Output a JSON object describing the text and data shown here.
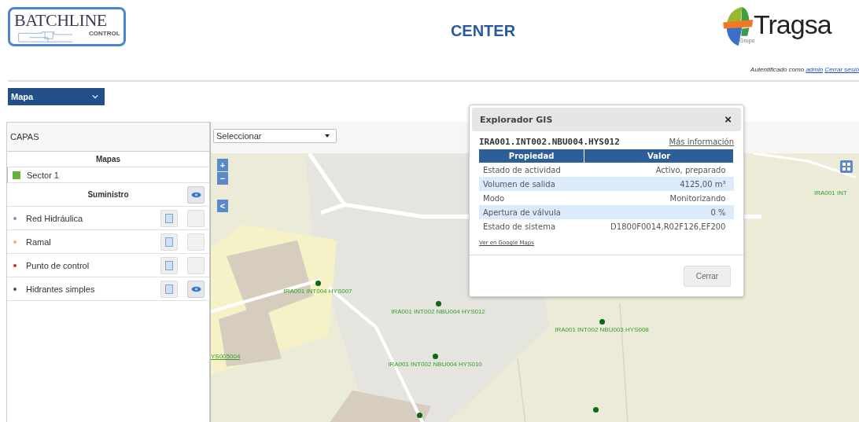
{
  "header": {
    "logo_text": "BATCHLINE",
    "logo_subtext": "CONTROL",
    "title": "CENTER",
    "brand_text": "Tragsa",
    "brand_subtext": "Grupo",
    "auth_label": "Autentificado como",
    "auth_user": "admin",
    "logout": "Cerrar sesió"
  },
  "view_select": {
    "value": "Mapa"
  },
  "layers_panel": {
    "title": "CAPAS",
    "rows": [
      {
        "kind": "section",
        "label": "Mapas"
      },
      {
        "kind": "map",
        "label": "Sector 1"
      },
      {
        "kind": "group",
        "label": "Suministro",
        "visible": true
      },
      {
        "kind": "layer",
        "label": "Red Hidráulica",
        "color": "#8a8ad0",
        "visible": false
      },
      {
        "kind": "layer",
        "label": "Ramal",
        "color": "#e8b070",
        "visible": false
      },
      {
        "kind": "layer",
        "label": "Punto de control",
        "color": "#e02020",
        "visible": false
      },
      {
        "kind": "layer",
        "label": "Hidrantes simples",
        "color": "#207020",
        "visible": true
      }
    ]
  },
  "map": {
    "select": {
      "value": "Seleccionar"
    },
    "zoom_in": "+",
    "zoom_out": "−",
    "collapse": "<",
    "markers": [
      {
        "kind": "labeled",
        "label": "IRA001 INT004 HYS007"
      },
      {
        "kind": "labeled",
        "label": "IRA001 INT002 NBU004 HYS012"
      },
      {
        "kind": "labeled",
        "label": "IRA001 INT002 NBU004 HYS010"
      },
      {
        "kind": "labeled",
        "label": "IRA001 INT002 NBU003 HYS008"
      },
      {
        "kind": "dot"
      },
      {
        "kind": "dot"
      },
      {
        "kind": "text",
        "label": "IRA001 INT"
      },
      {
        "kind": "link",
        "label": "YS005004"
      }
    ]
  },
  "gis_dialog": {
    "title": "Explorador GIS",
    "close": "×",
    "feature_id": "IRA001.INT002.NBU004.HYS012",
    "more_info": "Más información",
    "columns": [
      "Propiedad",
      "Valor"
    ],
    "rows": [
      [
        "Estado de actividad",
        "Activo, preparado"
      ],
      [
        "Volumen de salida",
        "4125,00 m³"
      ],
      [
        "Modo",
        "Monitorizando"
      ],
      [
        "Apertura de válvula",
        "0 %"
      ],
      [
        "Estado de sistema",
        "D1800F0014,R02F126,EF200"
      ]
    ],
    "map_link": "Ver en Google Maps",
    "button": "Cerrar"
  }
}
